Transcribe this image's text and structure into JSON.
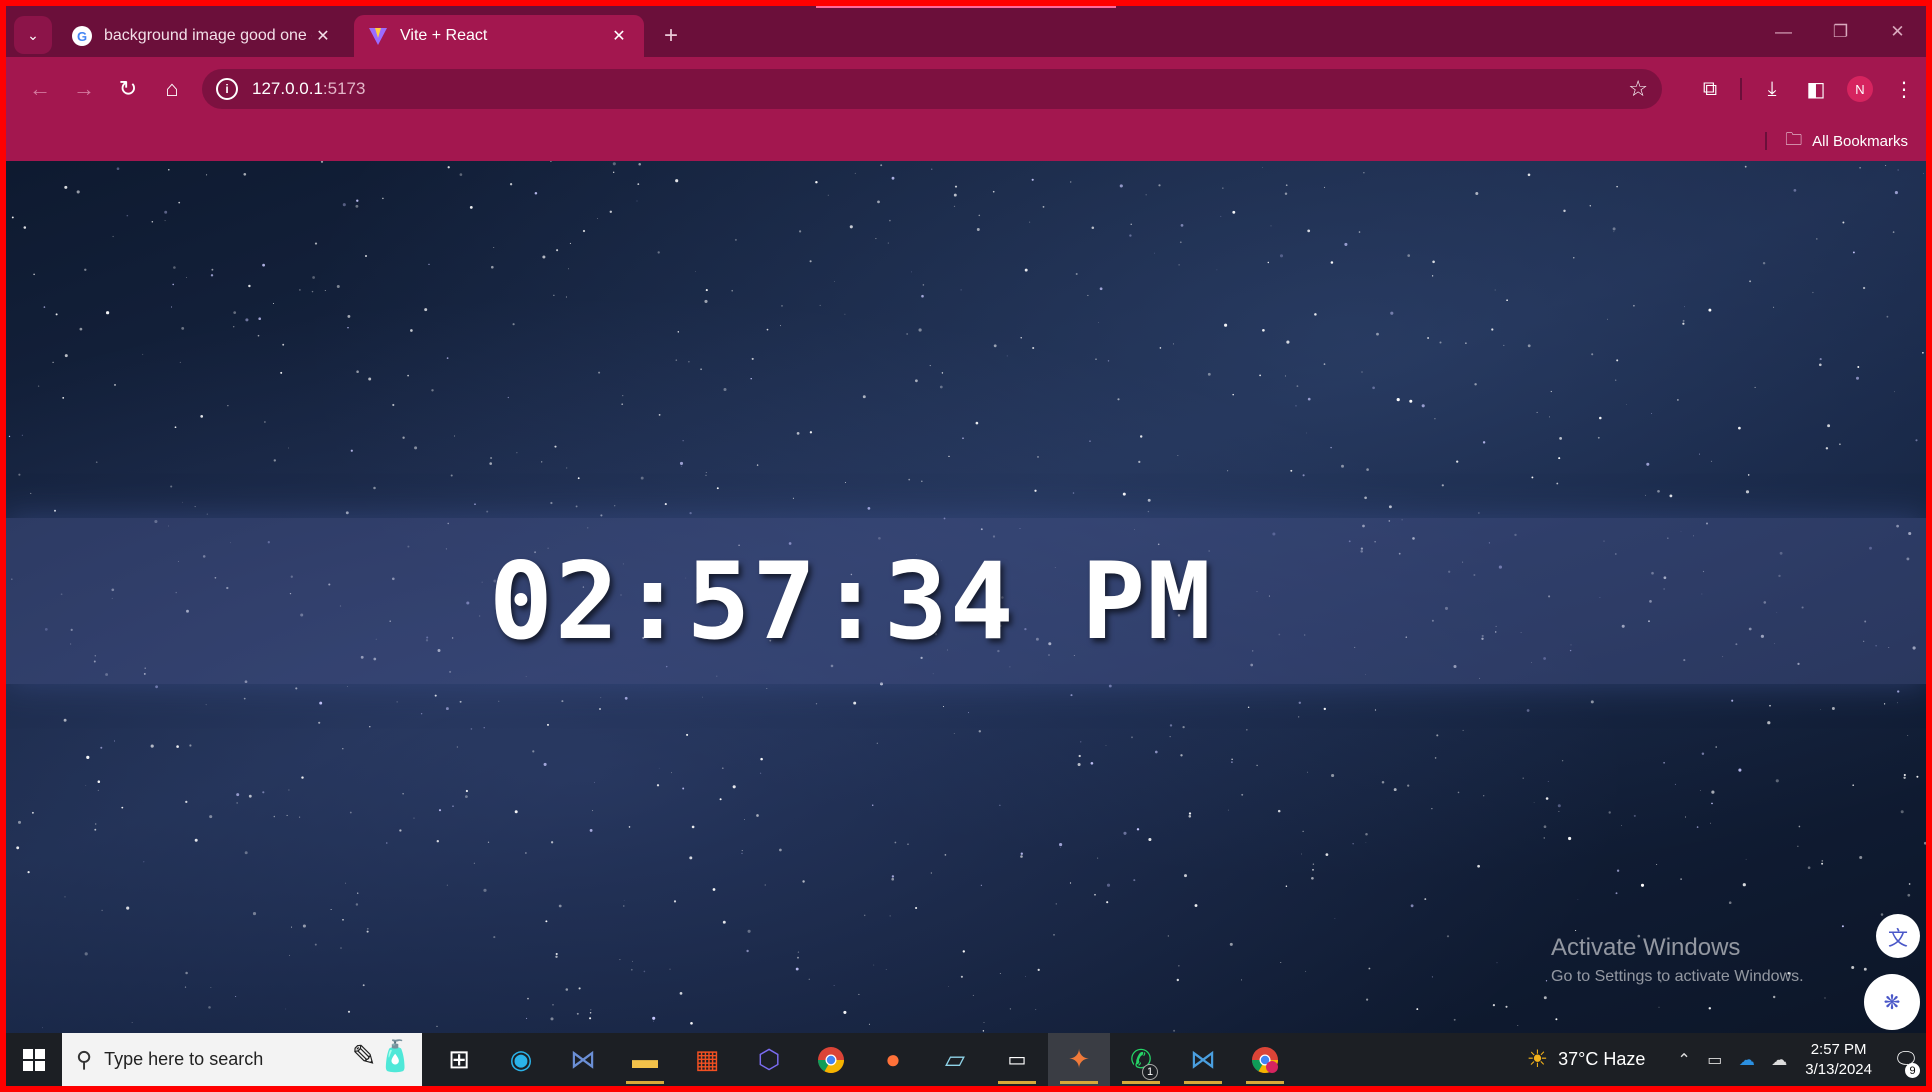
{
  "browser": {
    "tabs": [
      {
        "title": "background image good one -",
        "favicon": "google-g-icon",
        "active": false
      },
      {
        "title": "Vite + React",
        "favicon": "vite-icon",
        "active": true
      }
    ],
    "new_tab_symbol": "+",
    "address": {
      "host": "127.0.0.1",
      "port": ":5173"
    },
    "bookmarks_label": "All Bookmarks",
    "profile_initial": "N"
  },
  "page": {
    "clock_text": "02:57:34 PM",
    "watermark_title": "Activate Windows",
    "watermark_subtitle": "Go to Settings to activate Windows."
  },
  "taskbar": {
    "search_placeholder": "Type here to search",
    "weather": "37°C  Haze",
    "time": "2:57 PM",
    "date": "3/13/2024",
    "notification_count": "9",
    "whatsapp_badge": "1",
    "icons": [
      "task-view-icon",
      "edge-icon",
      "vscode-blue-icon",
      "file-explorer-icon",
      "ms-store-icon",
      "bing-icon",
      "chrome-icon",
      "firefox-icon",
      "notepad-icon",
      "terminal-icon",
      "paint-icon",
      "whatsapp-icon",
      "vscode-icon",
      "chrome-profile-icon"
    ]
  },
  "colors": {
    "tabstrip": "#6b0f3a",
    "toolbar": "#a3174f",
    "frame_border": "#ff0000"
  }
}
